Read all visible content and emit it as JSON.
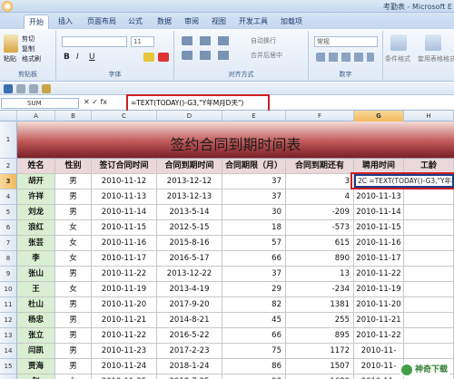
{
  "window": {
    "title": "考勤表 - Microsoft E"
  },
  "tabs": [
    "开始",
    "插入",
    "页面布局",
    "公式",
    "数据",
    "审阅",
    "视图",
    "开发工具",
    "加载项"
  ],
  "ribbon": {
    "clipboard": {
      "paste": "粘贴",
      "cut": "剪切",
      "copy": "复制",
      "format_painter": "格式刷",
      "label": "剪贴板"
    },
    "font": {
      "size": "11",
      "bold": "B",
      "italic": "I",
      "underline": "U",
      "label": "字体"
    },
    "alignment": {
      "wrap": "自动换行",
      "merge": "合并后居中",
      "label": "对齐方式"
    },
    "number": {
      "format": "常规",
      "label": "数字"
    },
    "styles": {
      "conditional": "条件格式",
      "table": "套用表格格式"
    }
  },
  "formula_bar": {
    "name_box": "SUM",
    "fx": "✕ ✓ fx",
    "formula": "=TEXT(TODAY()-G3,\"Y年M月D天\")"
  },
  "columns": [
    "A",
    "B",
    "C",
    "D",
    "E",
    "F",
    "G",
    "H"
  ],
  "sheet": {
    "title": "签约合同到期时间表",
    "headers": [
      "姓名",
      "性别",
      "签订合同时间",
      "合同到期时间",
      "合同期限（月）",
      "合同到期还有",
      "聘用时间",
      "工龄"
    ],
    "active_cell_text": "2C =TEXT(TODAY()-G3,\"Y年M",
    "rows": [
      {
        "n": "3",
        "name": "胡开",
        "sex": "男",
        "sign": "2010-11-12",
        "end": "2013-12-12",
        "term": "37",
        "left": "3",
        "hire": ""
      },
      {
        "n": "4",
        "name": "许祥",
        "sex": "男",
        "sign": "2010-11-13",
        "end": "2013-12-13",
        "term": "37",
        "left": "4",
        "hire": "2010-11-13"
      },
      {
        "n": "5",
        "name": "刘龙",
        "sex": "男",
        "sign": "2010-11-14",
        "end": "2013-5-14",
        "term": "30",
        "left": "-209",
        "hire": "2010-11-14"
      },
      {
        "n": "6",
        "name": "浪红",
        "sex": "女",
        "sign": "2010-11-15",
        "end": "2012-5-15",
        "term": "18",
        "left": "-573",
        "hire": "2010-11-15"
      },
      {
        "n": "7",
        "name": "张芸",
        "sex": "女",
        "sign": "2010-11-16",
        "end": "2015-8-16",
        "term": "57",
        "left": "615",
        "hire": "2010-11-16"
      },
      {
        "n": "8",
        "name": "李",
        "sex": "女",
        "sign": "2010-11-17",
        "end": "2016-5-17",
        "term": "66",
        "left": "890",
        "hire": "2010-11-17"
      },
      {
        "n": "9",
        "name": "张山",
        "sex": "男",
        "sign": "2010-11-22",
        "end": "2013-12-22",
        "term": "37",
        "left": "13",
        "hire": "2010-11-22"
      },
      {
        "n": "10",
        "name": "王",
        "sex": "女",
        "sign": "2010-11-19",
        "end": "2013-4-19",
        "term": "29",
        "left": "-234",
        "hire": "2010-11-19"
      },
      {
        "n": "11",
        "name": "杜山",
        "sex": "男",
        "sign": "2010-11-20",
        "end": "2017-9-20",
        "term": "82",
        "left": "1381",
        "hire": "2010-11-20"
      },
      {
        "n": "12",
        "name": "杨忠",
        "sex": "男",
        "sign": "2010-11-21",
        "end": "2014-8-21",
        "term": "45",
        "left": "255",
        "hire": "2010-11-21"
      },
      {
        "n": "13",
        "name": "张立",
        "sex": "男",
        "sign": "2010-11-22",
        "end": "2016-5-22",
        "term": "66",
        "left": "895",
        "hire": "2010-11-22"
      },
      {
        "n": "14",
        "name": "闫凯",
        "sex": "男",
        "sign": "2010-11-23",
        "end": "2017-2-23",
        "term": "75",
        "left": "1172",
        "hire": "2010-11-"
      },
      {
        "n": "15",
        "name": "贾海",
        "sex": "男",
        "sign": "2010-11-24",
        "end": "2018-1-24",
        "term": "86",
        "left": "1507",
        "hire": "2010-11-"
      },
      {
        "n": "16",
        "name": "赵",
        "sex": "女",
        "sign": "2010-11-25",
        "end": "2018-7-25",
        "term": "92",
        "left": "1689",
        "hire": "2010-11-"
      }
    ]
  },
  "watermark": "神奇下载",
  "colors": {
    "header_fill": "#ead7d9",
    "name_fill": "#d9eed2",
    "highlight": "#cc1e24",
    "active_border": "#1a3f8a"
  }
}
